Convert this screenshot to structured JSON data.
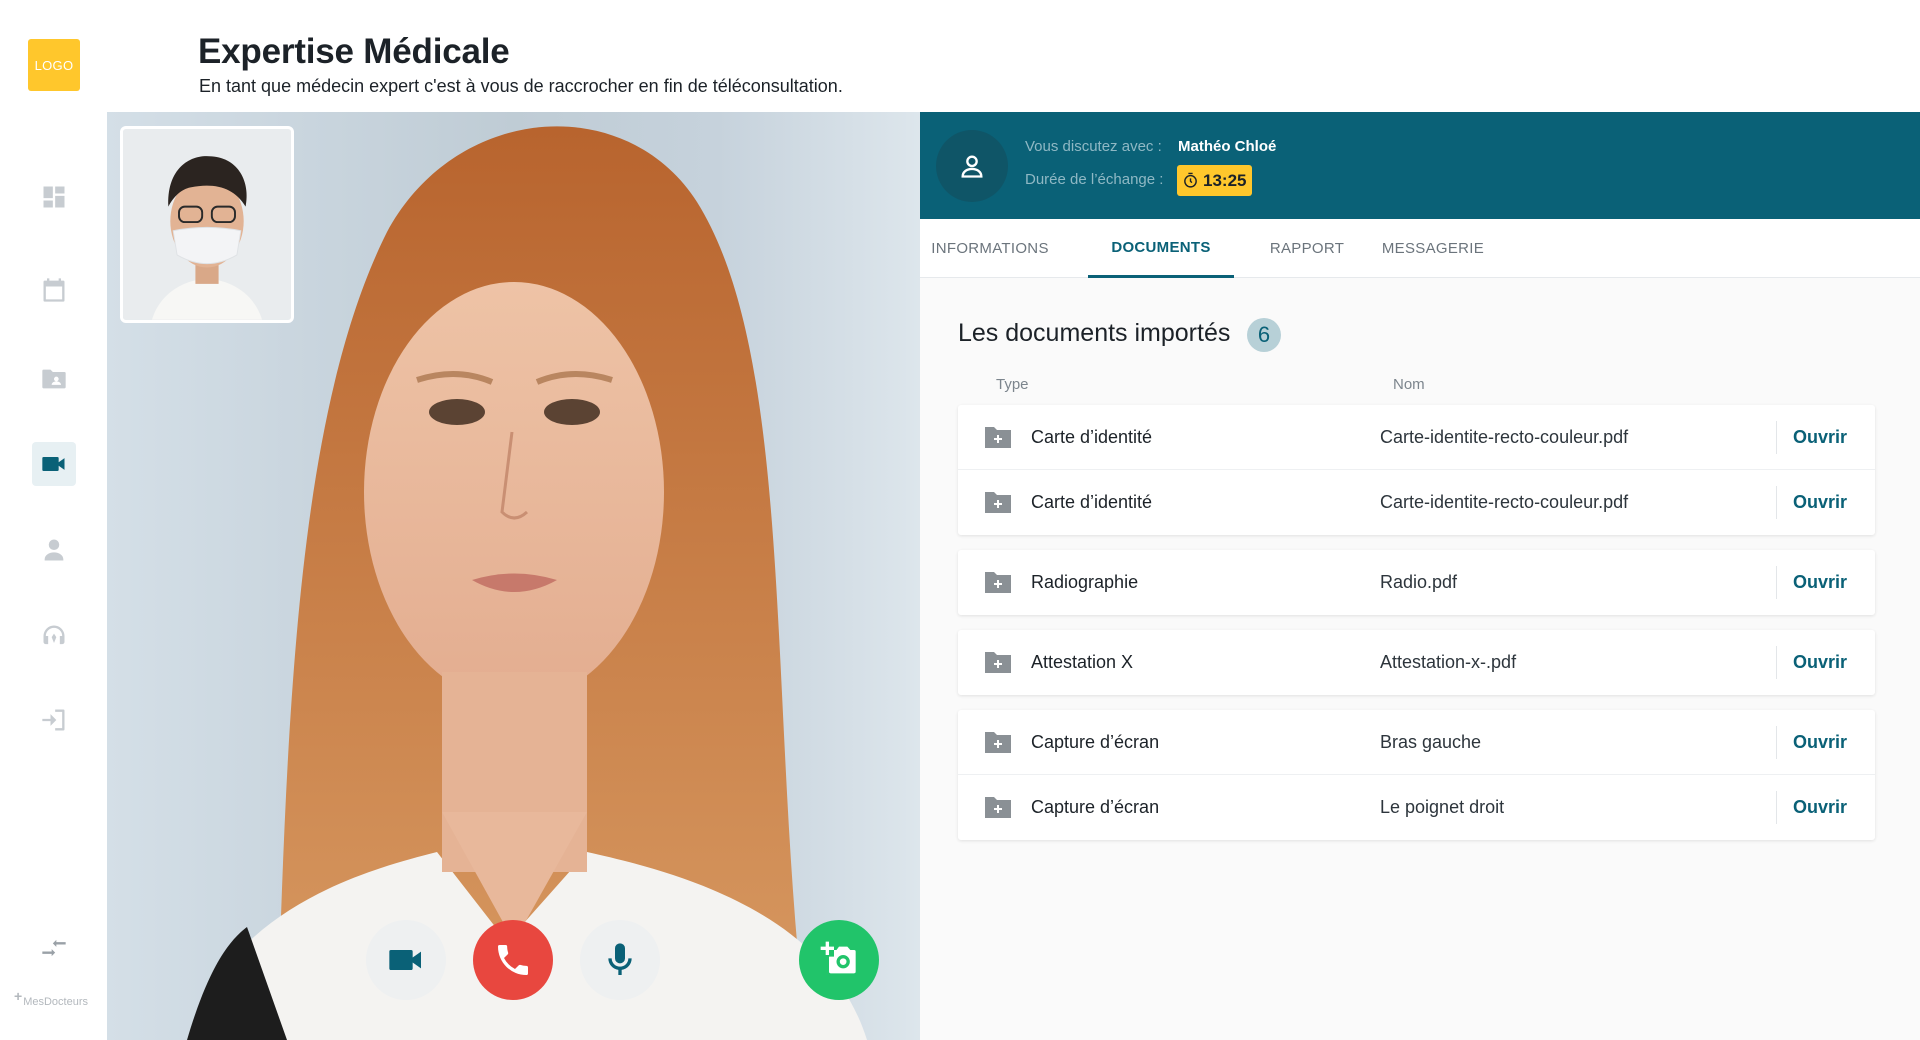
{
  "app": {
    "logo_text": "LOGO",
    "brand_text": "MesDocteurs"
  },
  "header": {
    "title": "Expertise Médicale",
    "subtitle": "En tant que médecin expert c'est à vous de raccrocher en fin de téléconsultation."
  },
  "sidebar": {
    "items": [
      {
        "icon": "dashboard-icon"
      },
      {
        "icon": "calendar-icon"
      },
      {
        "icon": "patient-folder-icon"
      },
      {
        "icon": "video-camera-icon",
        "active": true
      },
      {
        "icon": "user-icon"
      },
      {
        "icon": "support-headset-icon"
      },
      {
        "icon": "logout-icon"
      }
    ],
    "collapse_icon": "collapse-arrows-icon"
  },
  "call": {
    "with_label": "Vous discutez avec :",
    "with_name": "Mathéo Chloé",
    "duration_label": "Durée de l’échange :",
    "duration_value": "13:25",
    "controls": [
      "video-camera-icon",
      "hang-up-phone-icon",
      "microphone-icon",
      "add-photo-camera-icon"
    ]
  },
  "tabs": [
    {
      "label": "INFORMATIONS",
      "active": false
    },
    {
      "label": "DOCUMENTS",
      "active": true
    },
    {
      "label": "RAPPORT",
      "active": false
    },
    {
      "label": "MESSAGERIE",
      "active": false
    }
  ],
  "documents": {
    "title": "Les documents importés",
    "count": "6",
    "columns": {
      "type": "Type",
      "name": "Nom"
    },
    "groups": [
      {
        "rows": [
          {
            "type": "Carte d’identité",
            "name": "Carte-identite-recto-couleur.pdf",
            "action": "Ouvrir"
          },
          {
            "type": "Carte d’identité",
            "name": "Carte-identite-recto-couleur.pdf",
            "action": "Ouvrir"
          }
        ]
      },
      {
        "rows": [
          {
            "type": "Radiographie",
            "name": "Radio.pdf",
            "action": "Ouvrir"
          }
        ]
      },
      {
        "rows": [
          {
            "type": "Attestation X",
            "name": "Attestation-x-.pdf",
            "action": "Ouvrir"
          }
        ]
      },
      {
        "rows": [
          {
            "type": "Capture d’écran",
            "name": "Bras gauche",
            "action": "Ouvrir"
          },
          {
            "type": "Capture d’écran",
            "name": "Le poignet droit",
            "action": "Ouvrir"
          }
        ]
      }
    ]
  },
  "colors": {
    "primary": "#0a6177",
    "accent_yellow": "#ffc72c",
    "hangup_red": "#e8473f",
    "snapshot_green": "#21c46a"
  }
}
